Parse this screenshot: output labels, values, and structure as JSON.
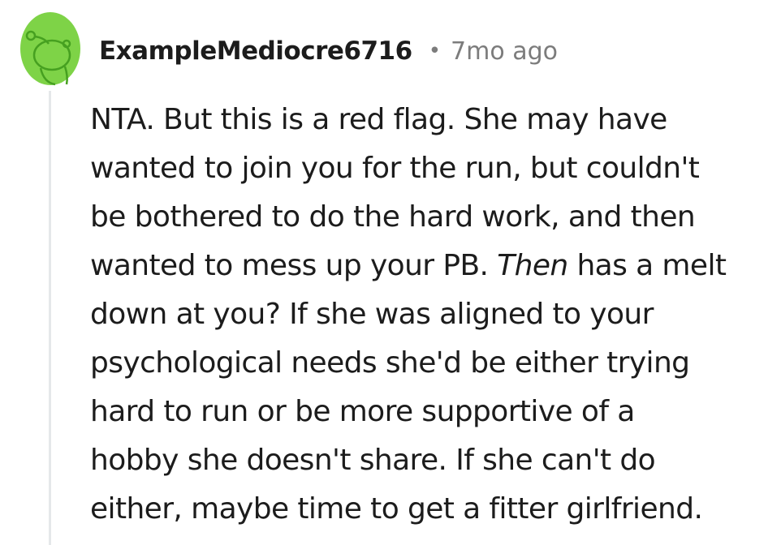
{
  "comment": {
    "author": "ExampleMediocre6716",
    "separator": "•",
    "timestamp": "7mo ago",
    "avatar_icon": "reddit-snoo-avatar-icon",
    "colors": {
      "avatar_bg": "#7ed347",
      "snoo_green": "#46a020",
      "text": "#1c1c1c",
      "meta": "#7c7c7c",
      "thread_line": "#e5e8ea"
    },
    "lines": [
      {
        "text": "NTA. But this is a red flag. She may have"
      },
      {
        "text": "wanted to join you for the run, but couldn't"
      },
      {
        "text": "be bothered to do the hard work, and then"
      },
      {
        "before": "wanted to mess up your PB. ",
        "emphasis": "Then",
        "after": " has a melt"
      },
      {
        "text": "down at you? If she was aligned to your"
      },
      {
        "text": "psychological needs she'd be either trying"
      },
      {
        "text": "hard to run or be more supportive of a"
      },
      {
        "text": "hobby she doesn't share. If she can't do"
      },
      {
        "text": "either, maybe time to get a fitter girlfriend."
      }
    ]
  }
}
